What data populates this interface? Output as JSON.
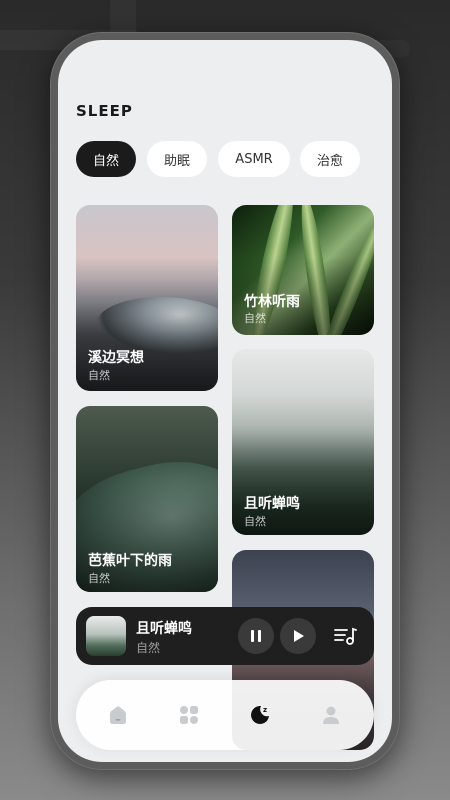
{
  "app": {
    "title": "SLEEP"
  },
  "categories": [
    {
      "label": "自然",
      "active": true
    },
    {
      "label": "助眠",
      "active": false
    },
    {
      "label": "ASMR",
      "active": false
    },
    {
      "label": "治愈",
      "active": false
    }
  ],
  "cards": [
    {
      "title": "溪边冥想",
      "subtitle": "自然"
    },
    {
      "title": "竹林听雨",
      "subtitle": "自然"
    },
    {
      "title": "芭蕉叶下的雨",
      "subtitle": "自然"
    },
    {
      "title": "且听蝉鸣",
      "subtitle": "自然"
    }
  ],
  "player": {
    "title": "且听蝉鸣",
    "subtitle": "自然",
    "state": "paused"
  },
  "tabbar": {
    "items": [
      {
        "icon": "home-icon",
        "active": false
      },
      {
        "icon": "grid-icon",
        "active": false
      },
      {
        "icon": "sleep-moon-icon",
        "active": true
      },
      {
        "icon": "profile-icon",
        "active": false
      }
    ]
  },
  "colors": {
    "accent": "#1b1b1b",
    "background": "#eceef0",
    "player": "#1f1f1f"
  }
}
